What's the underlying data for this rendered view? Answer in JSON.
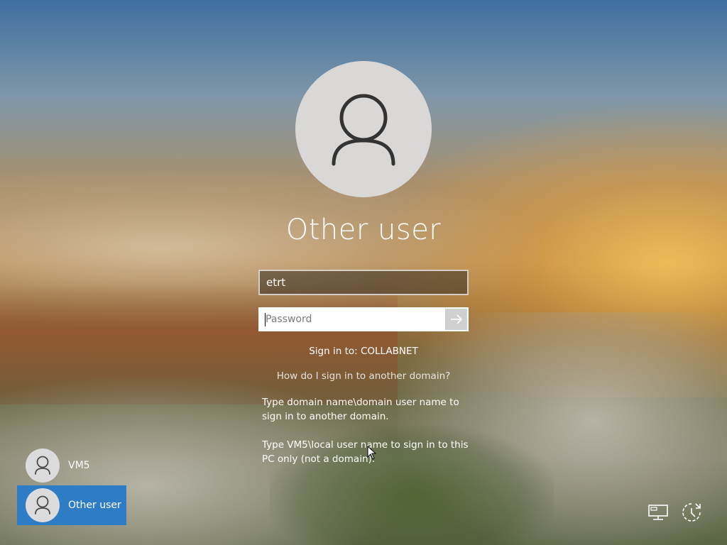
{
  "login": {
    "heading": "Other user",
    "username_value": "etrt",
    "password_placeholder": "Password",
    "sign_in_to": "Sign in to: COLLABNET",
    "help_link": "How do I sign in to another domain?",
    "hint_domain": "Type domain name\\domain user name to sign in to another domain.",
    "hint_local": "Type VM5\\local user name to sign in to this PC only (not a domain)."
  },
  "user_list": [
    {
      "label": "VM5",
      "selected": false
    },
    {
      "label": "Other user",
      "selected": true
    }
  ],
  "icons": {
    "avatar": "person-icon",
    "submit": "arrow-right-icon",
    "network": "network-icon",
    "ease_of_access": "ease-of-access-icon"
  },
  "colors": {
    "selected_tile": "#2e7bc6",
    "avatar_bg": "#d9d8d6",
    "text": "#ffffff"
  }
}
